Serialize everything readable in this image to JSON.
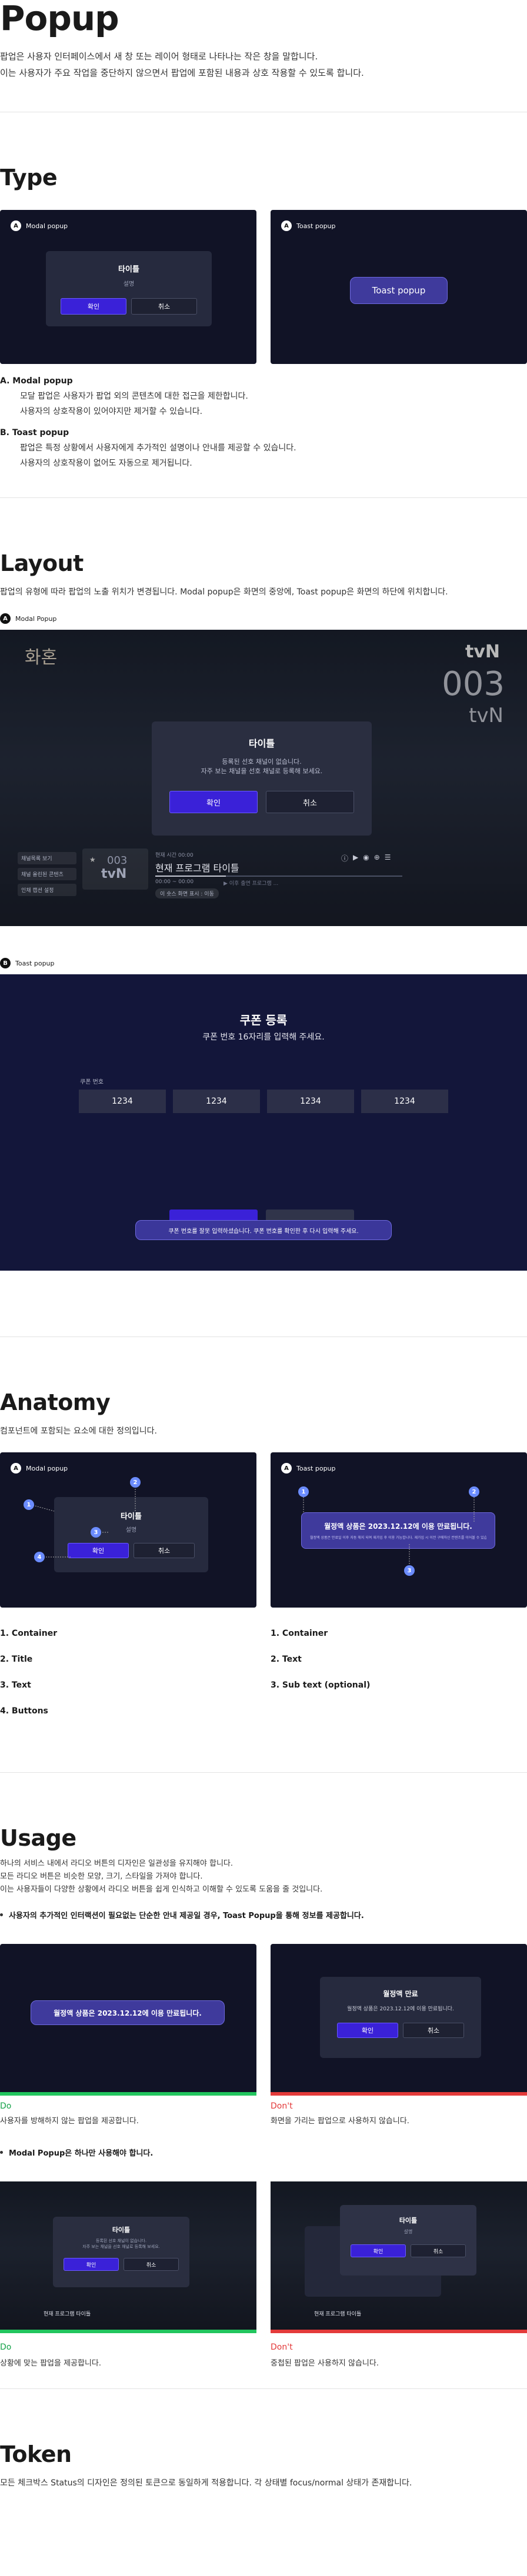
{
  "header": {
    "title": "Popup",
    "desc1": "팝업은 사용자 인터페이스에서 새 창 또는 레이어 형태로 나타나는 작은 창을 말합니다.",
    "desc2": "이는 사용자가 주요 작업을 중단하지 않으면서 팝업에 포함된 내용과 상호 작용할 수 있도록 합니다."
  },
  "type": {
    "title": "Type",
    "modal_card": {
      "badge": "A",
      "label": "Modal popup",
      "modal_title": "타이틀",
      "modal_sub": "설명",
      "ok": "확인",
      "cancel": "취소"
    },
    "toast_card": {
      "badge": "A",
      "label": "Toast popup",
      "toast_text": "Toast popup"
    },
    "a_head": "A. Modal popup",
    "a_line1": "모달 팝업은 사용자가 팝업 외의 콘텐츠에 대한 접근을 제한합니다.",
    "a_line2": "사용자의 상호작용이 있어야지만 제거할 수 있습니다.",
    "b_head": "B. Toast popup",
    "b_line1": "팝업은 특정 상황에서 사용자에게 추가적인 설명이나 안내를 제공할 수 있습니다.",
    "b_line2": "사용자의 상호작용이 없어도 자동으로 제거됩니다."
  },
  "layout": {
    "title": "Layout",
    "desc": "팝업의 유형에 따라 팝업의 노출 위치가 변경됩니다. Modal popup은 화면의 중앙에, Toast popup은 화면의 하단에 위치합니다.",
    "modal_badge": "A",
    "modal_label": "Modal Popup",
    "tv_logo_left": "화혼",
    "channel_brand": "tvN",
    "channel_num": "003",
    "channel_name": "tvN",
    "modal_title": "타이틀",
    "modal_text1": "등록된 선호 채널이 없습니다.",
    "modal_text2": "자주 보는 채널을 선호 채널로 등록해 보세요.",
    "ok": "확인",
    "cancel": "취소",
    "side_items": [
      "채널목록 보기",
      "채널 올린된 콘텐츠",
      "인채 캡션 설정"
    ],
    "bar_ch": "003",
    "bar_brand": "tvN",
    "bar_meta": "현재 시간 00:00",
    "bar_program": "현재 프로그램 타이틀",
    "bar_time": "00:00 ~ 00:00",
    "bar_next": "▶ 이후 출연 프로그램 ...",
    "bar_tag": "이 숏스 화면 표시 : 이동",
    "toast_badge": "B",
    "toast_label": "Toast popup",
    "coupon_title": "쿠폰 등록",
    "coupon_sub": "쿠폰 번호 16자리를 입력해 주세요.",
    "coupon_field_label": "쿠폰 번호",
    "coupon_fields": [
      "1234",
      "1234",
      "1234",
      "1234"
    ],
    "toast_msg": "쿠폰 번호를 잘못 입력하셨습니다. 쿠폰 번호를 확인한 후 다시 입력해 주세요."
  },
  "anatomy": {
    "title": "Anatomy",
    "desc": "컴포넌트에 포함되는 요소에 대한 정의입니다.",
    "modal_badge": "A",
    "modal_label": "Modal popup",
    "modal_title": "타이틀",
    "modal_sub": "설명",
    "ok": "확인",
    "cancel": "취소",
    "toast_badge": "A",
    "toast_label": "Toast popup",
    "toast_text": "월정액 상품은 2023.12.12에 이용 만료됩니다.",
    "toast_subtext": "월정액 상품은 만료일 이후 자동 해지 되며 재가입 후 이용 가능합니다. 재가입 시 이전 구매하신 컨텐츠를 이어볼 수 있습니다.",
    "marker_nums": [
      "1",
      "2",
      "3",
      "4"
    ],
    "modal_parts": [
      "1. Container",
      "2. Title",
      "3. Text",
      "4. Buttons"
    ],
    "toast_parts": [
      "1. Container",
      "2. Text",
      "3. Sub text (optional)"
    ]
  },
  "usage": {
    "title": "Usage",
    "desc1": "하나의 서비스 내에서 라디오 버튼의 디자인은 일관성을 유지해야 합니다.",
    "desc2": "모든 라디오 버튼은 비슷한 모양, 크기, 스타일을 가져야 합니다.",
    "desc3": "이는 사용자들이 다양한 상황에서 라디오 버튼을 쉽게 인식하고 이해할 수 있도록 도움을 줄 것입니다.",
    "bullet1": "사용자의 추가적인 인터랙션이 필요없는 단순한 안내 제공일 경우, Toast Popup을 통해 정보를 제공합니다.",
    "ex1_toast": "월정액 상품은 2023.12.12에 이용 만료됩니다.",
    "ex1_do": "Do",
    "ex1_do_cap": "사용자를 방해하지 않는 팝업을 제공합니다.",
    "ex2_title": "월정액 만료",
    "ex2_text": "월정액 상품은 2023.12.12에 이용 만료됩니다.",
    "ok": "확인",
    "cancel": "취소",
    "ex2_dont": "Don't",
    "ex2_dont_cap": "화면을 가리는 팝업으로 사용하지 않습니다.",
    "bullet2": "Modal Popup은 하나만 사용해야 합니다.",
    "ex3_title": "타이틀",
    "ex3_text1": "등록된 선호 채널이 없습니다.",
    "ex3_text2": "자주 보는 채널을 선호 채널로 등록해 보세요.",
    "ex3_program": "현재 프로그램 타이틀",
    "ex3_do": "Do",
    "ex3_do_cap": "상황에 맞는 팝업을 제공합니다.",
    "ex4_title": "타이틀",
    "ex4_sub": "설명",
    "ex4_dont": "Don't",
    "ex4_dont_cap": "중첩된 팝업은 사용하지 않습니다."
  },
  "token": {
    "title": "Token",
    "desc": "모든 체크박스 Status의 디자인은 정의된 토큰으로 동일하게 적용합니다. 각 상태별 focus/normal 상태가 존재합니다."
  },
  "colors": {
    "dark": "#111326",
    "modal": "#262a3e",
    "accent": "#3a21d8",
    "do": "#22c55e",
    "dont": "#e33a3a"
  }
}
